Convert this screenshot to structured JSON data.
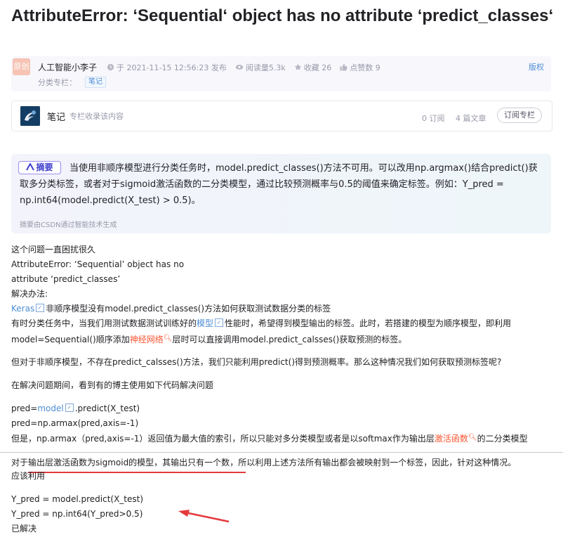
{
  "title": "AttributeError: ‘Sequential‘ object has no attribute ‘predict_classes‘",
  "meta": {
    "badge": "原创",
    "author": "人工智能小李子",
    "published": "于 2021-11-15 12:56:23 发布",
    "views": "阅读量5.3k",
    "favorites": "收藏 26",
    "likes": "点赞数 9",
    "copyright": "版权",
    "category_label": "分类专栏：",
    "category_tag": "笔记"
  },
  "column": {
    "name": "笔记",
    "desc": "专栏收录该内容",
    "subscribers": "0 订阅",
    "articles": "4 篇文章",
    "subscribe_button": "订阅专栏"
  },
  "summary": {
    "badge": "摘要",
    "text": "当使用非顺序模型进行分类任务时，model.predict_classes()方法不可用。可以改用np.argmax()结合predict()获取多分类标签，或者对于sigmoid激活函数的二分类模型，通过比较预测概率与0.5的阈值来确定标签。例如：Y_pred = np.int64(model.predict(X_test) > 0.5)。",
    "note": "摘要由CSDN通过智能技术生成"
  },
  "content": {
    "l1": "这个问题一直困扰很久",
    "l2": "AttributeError: ‘Sequential’ object has no",
    "l3": "attribute ‘predict_classes’",
    "l4": "解决办法:",
    "l5_link": "Keras",
    "l5_rest": "非顺序模型没有model.predict_classes()方法如何获取测试数据分类的标签",
    "l6_a": "有时分类任务中，当我们用测试数据测试训练好的",
    "l6_link": "模型",
    "l6_b": "性能时，希望得到模型输出的标签。此时，若搭建的模型为顺序模型，即利用",
    "l7_a": "model=Sequential()顺序添加",
    "l7_link": "神经网络",
    "l7_b": "层时可以直接调用model.predict_calsses()获取预测的标签。",
    "l8": "但对于非顺序模型，不存在predict_calsses()方法，我们只能利用predict()得到预测概率。那么这种情况我们如何获取预测标签呢?",
    "l9": "在解决问题期间，看到有的博主使用如下代码解决问题",
    "l10_a": "pred=",
    "l10_link": "model",
    "l10_b": ".predict(X_test)",
    "l11": "pred=np.armax(pred,axis=-1)",
    "l12_a": "但是，np.armax（pred,axis=-1）返回值为最大值的索引，所以只能对多分类模型或者是以softmax作为输出层",
    "l12_link": "激活函数",
    "l12_b": "的二分类模型",
    "l13": "对于输出层激活函数为sigmoid的模型，其输出只有一个数，所以利用上述方法所有输出都会被映射到一个标签，因此，针对这种情况。",
    "l14": "应该利用",
    "l15": "Y_pred = model.predict(X_test)",
    "l16": "Y_pred = np.int64(Y_pred>0.5)",
    "l17": "已解决"
  }
}
